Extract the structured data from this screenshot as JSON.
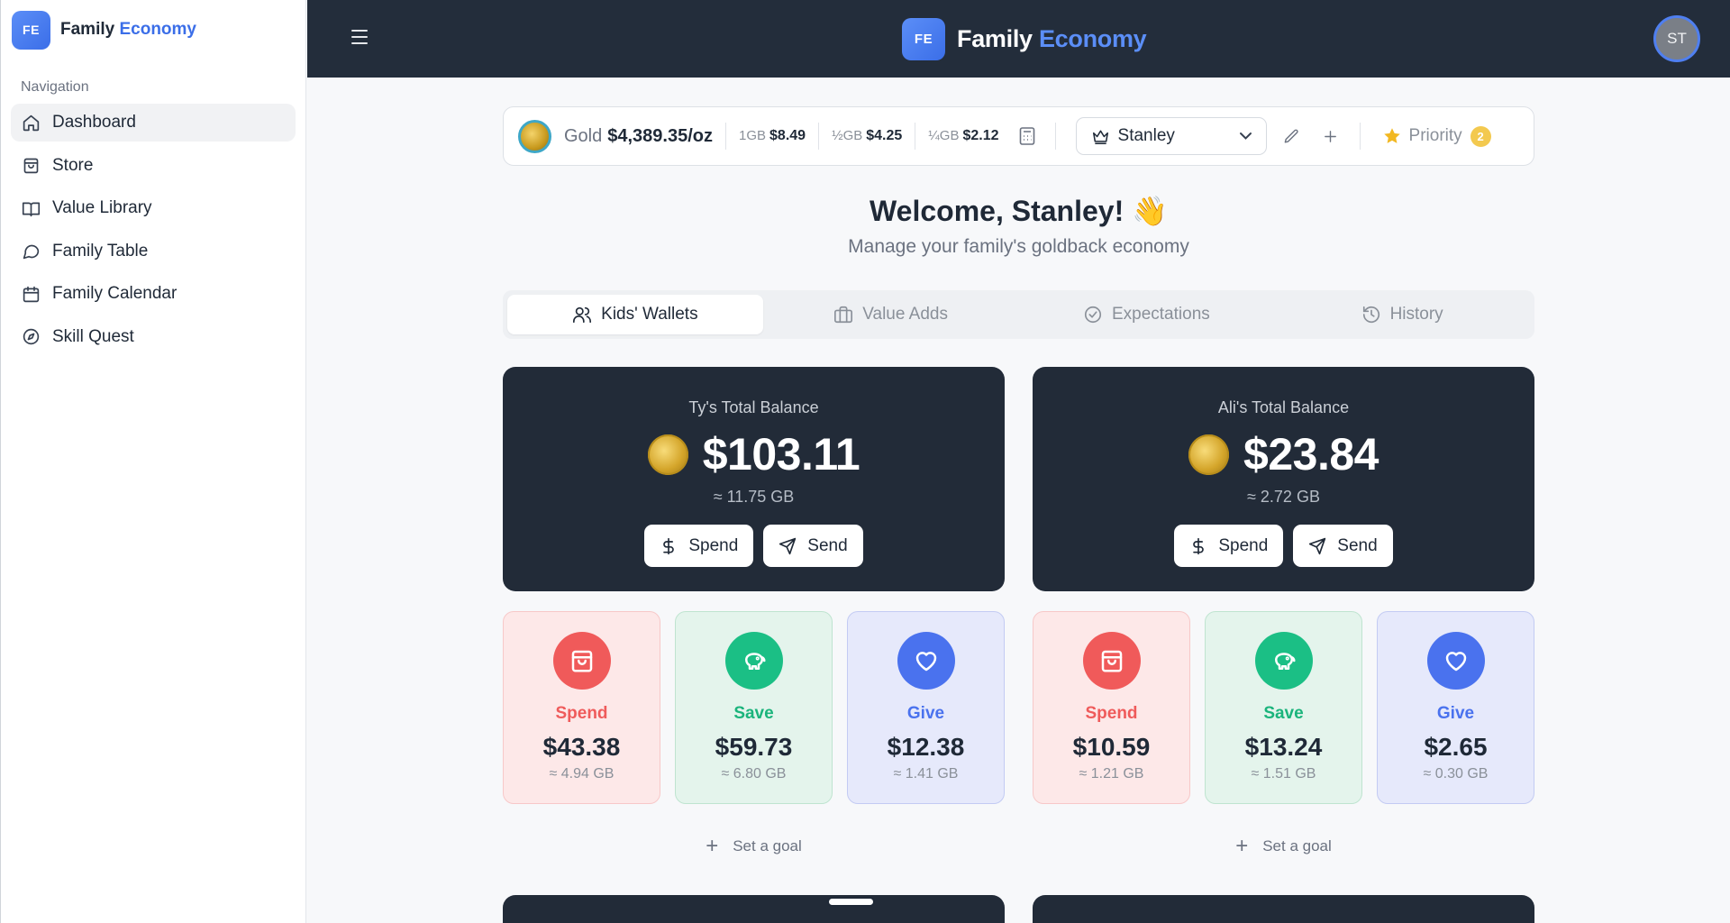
{
  "app": {
    "brand_prefix": "Family",
    "brand_accent": "Economy",
    "logo_initials": "FE"
  },
  "sidebar": {
    "heading": "Navigation",
    "items": [
      {
        "label": "Dashboard",
        "icon": "home-icon",
        "active": true
      },
      {
        "label": "Store",
        "icon": "bag-icon"
      },
      {
        "label": "Value Library",
        "icon": "book-icon"
      },
      {
        "label": "Family Table",
        "icon": "chat-icon"
      },
      {
        "label": "Family Calendar",
        "icon": "calendar-icon"
      },
      {
        "label": "Skill Quest",
        "icon": "compass-icon"
      }
    ]
  },
  "header": {
    "avatar_initials": "ST"
  },
  "pricebar": {
    "gold_label": "Gold",
    "gold_price": "$4,389.35/oz",
    "denoms": [
      {
        "label": "1GB",
        "value": "$8.49"
      },
      {
        "label": "½GB",
        "value": "$4.25"
      },
      {
        "label": "¼GB",
        "value": "$2.12"
      }
    ],
    "selected_user": "Stanley",
    "priority_label": "Priority",
    "priority_count": "2"
  },
  "welcome": {
    "title": "Welcome, Stanley! 👋",
    "subtitle": "Manage your family's goldback economy"
  },
  "tabs": [
    {
      "label": "Kids' Wallets",
      "icon": "users-icon",
      "active": true
    },
    {
      "label": "Value Adds",
      "icon": "briefcase-icon"
    },
    {
      "label": "Expectations",
      "icon": "check-circle-icon"
    },
    {
      "label": "History",
      "icon": "history-icon"
    }
  ],
  "wallets": [
    {
      "title": "Ty's Total Balance",
      "amount": "$103.11",
      "gb": "≈ 11.75 GB",
      "spend_btn": "Spend",
      "send_btn": "Send",
      "buckets": {
        "spend": {
          "label": "Spend",
          "amount": "$43.38",
          "gb": "≈ 4.94 GB"
        },
        "save": {
          "label": "Save",
          "amount": "$59.73",
          "gb": "≈ 6.80 GB"
        },
        "give": {
          "label": "Give",
          "amount": "$12.38",
          "gb": "≈ 1.41 GB"
        }
      },
      "goal": "Set a goal"
    },
    {
      "title": "Ali's Total Balance",
      "amount": "$23.84",
      "gb": "≈ 2.72 GB",
      "spend_btn": "Spend",
      "send_btn": "Send",
      "buckets": {
        "spend": {
          "label": "Spend",
          "amount": "$10.59",
          "gb": "≈ 1.21 GB"
        },
        "save": {
          "label": "Save",
          "amount": "$13.24",
          "gb": "≈ 1.51 GB"
        },
        "give": {
          "label": "Give",
          "amount": "$2.65",
          "gb": "≈ 0.30 GB"
        }
      },
      "goal": "Set a goal"
    }
  ],
  "colors": {
    "header_bg": "#232d3b",
    "accent": "#3b6ee8",
    "spend": "#f05a5a",
    "save": "#1bbf85",
    "give": "#4a72ee"
  }
}
